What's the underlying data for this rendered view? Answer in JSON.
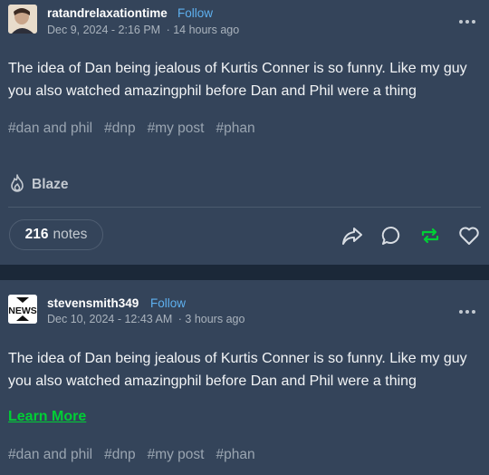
{
  "post1": {
    "username": "ratandrelaxationtime",
    "follow_label": "Follow",
    "date": "Dec 9, 2024 - 2:16 PM",
    "relative_time": "· 14 hours ago",
    "body": "The idea of Dan being jealous of Kurtis Conner is so funny. Like my guy you also watched amazingphil before Dan and Phil were a thing",
    "tags": [
      "#dan and phil",
      "#dnp",
      "#my post",
      "#phan"
    ],
    "blaze_label": "Blaze",
    "notes_count": "216",
    "notes_label": "notes"
  },
  "post2": {
    "avatar_text": "NEWS",
    "username": "stevensmith349",
    "follow_label": "Follow",
    "date": "Dec 10, 2024 - 12:43 AM",
    "relative_time": "· 3 hours ago",
    "body": "The idea of Dan being jealous of Kurtis Conner is so funny. Like my guy you also watched amazingphil before Dan and Phil were a thing",
    "learn_more": "Learn More",
    "tags": [
      "#dan and phil",
      "#dnp",
      "#my post",
      "#phan"
    ]
  },
  "colors": {
    "background": "#1b2838",
    "card": "#34445a",
    "accent": "#5eb0ef",
    "reblog": "#00cf35"
  }
}
